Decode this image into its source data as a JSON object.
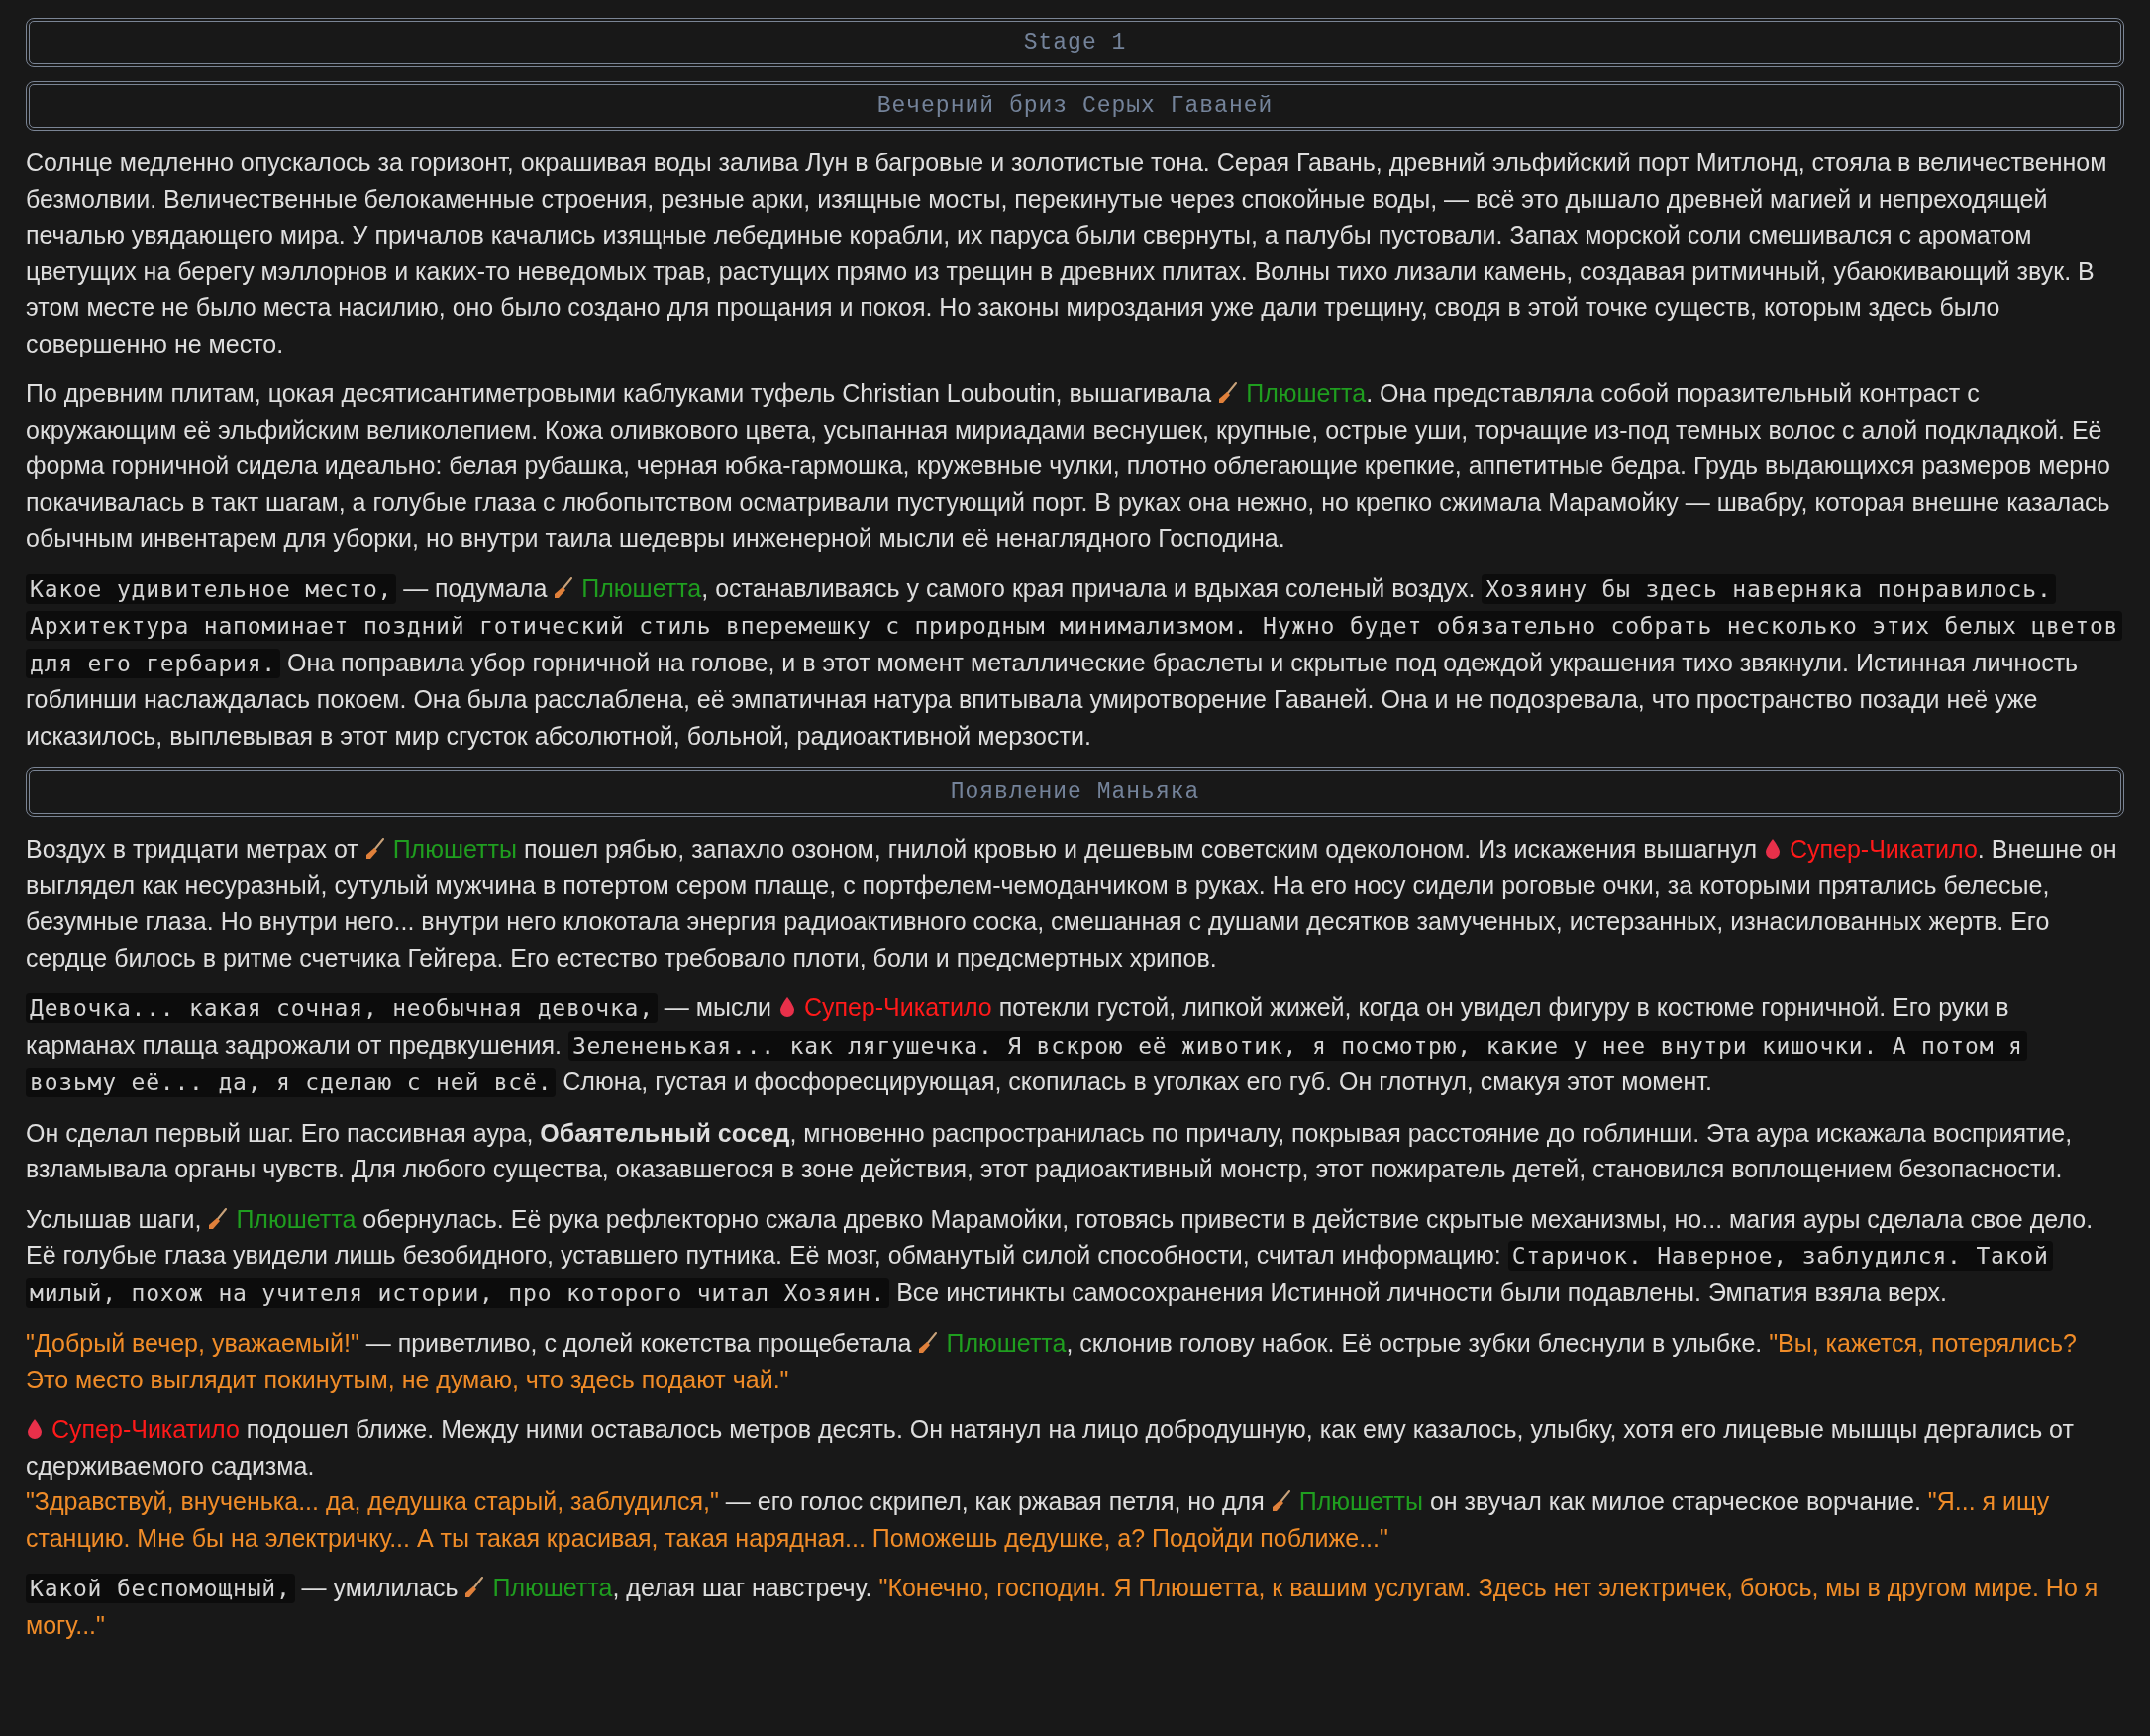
{
  "blocks": [
    {
      "kind": "heading",
      "text": "Stage 1"
    },
    {
      "kind": "heading",
      "text": "Вечерний бриз Серых Гаваней"
    },
    {
      "kind": "paragraph",
      "segments": [
        {
          "kind": "text",
          "text": "Солнце медленно опускалось за горизонт, окрашивая воды залива Лун в багровые и золотистые тона. Серая Гавань, древний эльфийский порт Митлонд, стояла в величественном безмолвии. Величественные белокаменные строения, резные арки, изящные мосты, перекинутые через спокойные воды, — всё это дышало древней магией и непреходящей печалью увядающего мира. У причалов качались изящные лебединые корабли, их паруса были свернуты, а палубы пустовали. Запах морской соли смешивался с ароматом цветущих на берегу мэллорнов и каких-то неведомых трав, растущих прямо из трещин в древних плитах. Волны тихо лизали камень, создавая ритмичный, убаюкивающий звук. В этом месте не было места насилию, оно было создано для прощания и покоя. Но законы мироздания уже дали трещину, сводя в этой точке существ, которым здесь было совершенно не место."
        }
      ]
    },
    {
      "kind": "paragraph",
      "segments": [
        {
          "kind": "text",
          "text": "По древним плитам, цокая десятисантиметровыми каблуками туфель Christian Louboutin, вышагивала "
        },
        {
          "kind": "maid",
          "color": "#1f9e1f",
          "text": "Плюшетта"
        },
        {
          "kind": "text",
          "text": ". Она представляла собой поразительный контраст с окружающим её эльфийским великолепием. Кожа оливкового цвета, усыпанная мириадами веснушек, крупные, острые уши, торчащие из-под темных волос с алой подкладкой. Её форма горничной сидела идеально: белая рубашка, черная юбка-гармошка, кружевные чулки, плотно облегающие крепкие, аппетитные бедра. Грудь выдающихся размеров мерно покачивалась в такт шагам, а голубые глаза с любопытством осматривали пустующий порт. В руках она нежно, но крепко сжимала Марамойку — швабру, которая внешне казалась обычным инвентарем для уборки, но внутри таила шедевры инженерной мысли её ненаглядного Господина."
        }
      ]
    },
    {
      "kind": "paragraph",
      "segments": [
        {
          "kind": "thought",
          "text": "Какое удивительное место,"
        },
        {
          "kind": "text",
          "text": " — подумала "
        },
        {
          "kind": "maid",
          "color": "#1f9e1f",
          "text": "Плюшетта"
        },
        {
          "kind": "text",
          "text": ", останавливаясь у самого края причала и вдыхая соленый воздух. "
        },
        {
          "kind": "thought",
          "text": "Хозяину бы здесь наверняка понравилось. Архитектура напоминает поздний готический стиль вперемешку с природным минимализмом. Нужно будет обязательно собрать несколько этих белых цветов для его гербария."
        },
        {
          "kind": "text",
          "text": " Она поправила убор горничной на голове, и в этот момент металлические браслеты и скрытые под одеждой украшения тихо звякнули. Истинная личность гоблинши наслаждалась покоем. Она была расслаблена, её эмпатичная натура впитывала умиротворение Гаваней. Она и не подозревала, что пространство позади неё уже исказилось, выплевывая в этот мир сгусток абсолютной, больной, радиоактивной мерзости."
        }
      ]
    },
    {
      "kind": "heading",
      "text": "Появление Маньяка"
    },
    {
      "kind": "paragraph",
      "segments": [
        {
          "kind": "text",
          "text": "Воздух в тридцати метрах от "
        },
        {
          "kind": "maid",
          "color": "#1f9e1f",
          "text": "Плюшетты"
        },
        {
          "kind": "text",
          "text": " пошел рябью, запахло озоном, гнилой кровью и дешевым советским одеколоном. Из искажения вышагнул "
        },
        {
          "kind": "maniac",
          "color": "#ff1a1a",
          "text": "Супер-Чикатило"
        },
        {
          "kind": "text",
          "text": ". Внешне он выглядел как несуразный, сутулый мужчина в потертом сером плаще, с портфелем-чемоданчиком в руках. На его носу сидели роговые очки, за которыми прятались белесые, безумные глаза. Но внутри него... внутри него клокотала энергия радиоактивного соска, смешанная с душами десятков замученных, истерзанных, изнасилованных жертв. Его сердце билось в ритме счетчика Гейгера. Его естество требовало плоти, боли и предсмертных хрипов."
        }
      ]
    },
    {
      "kind": "paragraph",
      "segments": [
        {
          "kind": "thought",
          "text": "Девочка... какая сочная, необычная девочка,"
        },
        {
          "kind": "text",
          "text": " — мысли "
        },
        {
          "kind": "maniac",
          "color": "#ff1a1a",
          "text": "Супер-Чикатило"
        },
        {
          "kind": "text",
          "text": " потекли густой, липкой жижей, когда он увидел фигуру в костюме горничной. Его руки в карманах плаща задрожали от предвкушения. "
        },
        {
          "kind": "thought",
          "text": "Зелененькая... как лягушечка. Я вскрою её животик, я посмотрю, какие у нее внутри кишочки. А потом я возьму её... да, я сделаю с ней всё."
        },
        {
          "kind": "text",
          "text": " Слюна, густая и фосфоресцирующая, скопилась в уголках его губ. Он глотнул, смакуя этот момент."
        }
      ]
    },
    {
      "kind": "paragraph",
      "segments": [
        {
          "kind": "text",
          "text": "Он сделал первый шаг. Его пассивная аура, **Обаятельный сосед**, мгновенно распространилась по причалу, покрывая расстояние до гоблинши. Эта аура искажала восприятие, взламывала органы чувств. Для любого существа, оказавшегося в зоне действия, этот радиоактивный монстр, этот пожиратель детей, становился воплощением безопасности."
        }
      ]
    },
    {
      "kind": "paragraph",
      "segments": [
        {
          "kind": "text",
          "text": "Услышав шаги, "
        },
        {
          "kind": "maid",
          "color": "#1f9e1f",
          "text": "Плюшетта"
        },
        {
          "kind": "text",
          "text": " обернулась. Её рука рефлекторно сжала древко Марамойки, готовясь привести в действие скрытые механизмы, но... магия ауры сделала свое дело. Её голубые глаза увидели лишь безобидного, уставшего путника. Её мозг, обманутый силой способности, считал информацию: "
        },
        {
          "kind": "thought",
          "text": "Старичок. Наверное, заблудился. Такой милый, похож на учителя истории, про которого читал Хозяин."
        },
        {
          "kind": "text",
          "text": " Все инстинкты самосохранения Истинной личности были подавлены. Эмпатия взяла верх."
        }
      ]
    },
    {
      "kind": "paragraph",
      "segments": [
        {
          "kind": "speech",
          "text": "\"Добрый вечер, уважаемый!\""
        },
        {
          "kind": "text",
          "text": " — приветливо, с долей кокетства прощебетала "
        },
        {
          "kind": "maid",
          "color": "#1f9e1f",
          "text": "Плюшетта"
        },
        {
          "kind": "text",
          "text": ", склонив голову набок. Её острые зубки блеснули в улыбке. "
        },
        {
          "kind": "speech",
          "text": "\"Вы, кажется, потерялись? Это место выглядит покинутым, не думаю, что здесь подают чай.\""
        }
      ]
    },
    {
      "kind": "paragraph",
      "segments": [
        {
          "kind": "maniac",
          "color": "#ff1a1a",
          "text": "Супер-Чикатило"
        },
        {
          "kind": "text",
          "text": " подошел ближе. Между ними оставалось метров десять. Он натянул на лицо добродушную, как ему казалось, улыбку, хотя его лицевые мышцы дергались от сдерживаемого садизма."
        },
        {
          "kind": "break"
        },
        {
          "kind": "speech",
          "text": "\"Здравствуй, внученька... да, дедушка старый, заблудился,\""
        },
        {
          "kind": "text",
          "text": " — его голос скрипел, как ржавая петля, но для "
        },
        {
          "kind": "maid",
          "color": "#1f9e1f",
          "text": "Плюшетты"
        },
        {
          "kind": "text",
          "text": " он звучал как милое старческое ворчание. "
        },
        {
          "kind": "speech",
          "text": "\"Я... я ищу станцию. Мне бы на электричку... А ты такая красивая, такая нарядная... Поможешь дедушке, а? Подойди поближе...\""
        }
      ]
    },
    {
      "kind": "paragraph",
      "segments": [
        {
          "kind": "thought",
          "text": "Какой беспомощный,"
        },
        {
          "kind": "text",
          "text": " — умилилась "
        },
        {
          "kind": "maid",
          "color": "#1f9e1f",
          "text": "Плюшетта"
        },
        {
          "kind": "text",
          "text": ", делая шаг навстречу. "
        },
        {
          "kind": "speech",
          "text": "\"Конечно, господин. Я Плюшетта, к вашим услугам. Здесь нет электричек, боюсь, мы в другом мире. Но я могу...\""
        }
      ]
    }
  ]
}
